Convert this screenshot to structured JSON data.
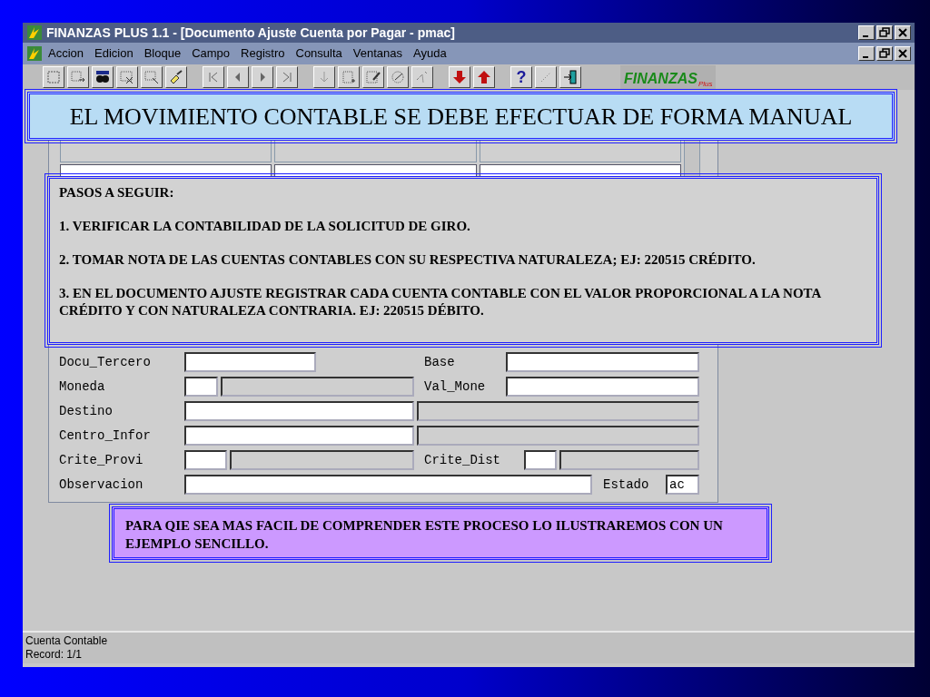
{
  "window": {
    "title": "FINANZAS PLUS 1.1 - [Documento Ajuste Cuenta por Pagar - pmac]"
  },
  "menu": [
    "Accion",
    "Edicion",
    "Bloque",
    "Campo",
    "Registro",
    "Consulta",
    "Ventanas",
    "Ayuda"
  ],
  "toolbar": {
    "help_label": "?",
    "logo": "FINANZAS",
    "logo_sub": "Plus"
  },
  "form": {
    "rows": [
      {
        "fields": [
          {
            "kind": "label",
            "text": "Docu_Tercero"
          },
          {
            "kind": "input"
          },
          {
            "kind": "label",
            "text": "Base"
          },
          {
            "kind": "input"
          }
        ]
      },
      {
        "fields": [
          {
            "kind": "label",
            "text": "Moneda"
          },
          {
            "kind": "input"
          },
          {
            "kind": "display"
          },
          {
            "kind": "label",
            "text": "Val_Mone"
          },
          {
            "kind": "input"
          }
        ]
      },
      {
        "fields": [
          {
            "kind": "label",
            "text": "Destino"
          },
          {
            "kind": "input"
          },
          {
            "kind": "display"
          }
        ]
      },
      {
        "fields": [
          {
            "kind": "label",
            "text": "Centro_Infor"
          },
          {
            "kind": "input"
          },
          {
            "kind": "display"
          }
        ]
      },
      {
        "fields": [
          {
            "kind": "label",
            "text": "Crite_Provi"
          },
          {
            "kind": "input"
          },
          {
            "kind": "display"
          },
          {
            "kind": "label",
            "text": "Crite_Dist"
          },
          {
            "kind": "input"
          },
          {
            "kind": "display"
          }
        ]
      },
      {
        "fields": [
          {
            "kind": "label",
            "text": "Observacion"
          },
          {
            "kind": "input"
          },
          {
            "kind": "label",
            "text": "Estado"
          },
          {
            "kind": "input",
            "value": "ac"
          }
        ]
      }
    ]
  },
  "notes": [
    {
      "kind": "banner",
      "lines": [
        "EL MOVIMIENTO CONTABLE SE DEBE EFECTUAR DE FORMA MANUAL"
      ]
    },
    {
      "kind": "steps",
      "lines": [
        "PASOS A SEGUIR:",
        "1. VERIFICAR LA CONTABILIDAD DE LA SOLICITUD DE GIRO.",
        "2. TOMAR NOTA DE LAS CUENTAS CONTABLES CON SU RESPECTIVA NATURALEZA; EJ: 220515 CRÉDITO.",
        "3. EN EL DOCUMENTO AJUSTE  REGISTRAR CADA CUENTA CONTABLE CON EL VALOR PROPORCIONAL A LA NOTA CRÉDITO Y CON NATURALEZA CONTRARIA. EJ: 220515 DÉBITO."
      ]
    },
    {
      "kind": "callout",
      "lines": [
        "PARA QIE SEA MAS  FACIL DE COMPRENDER ESTE PROCESO LO ILUSTRAREMOS CON UN EJEMPLO SENCILLO."
      ]
    }
  ],
  "status_bar": [
    "Cuenta Contable",
    "Record: 1/1"
  ]
}
